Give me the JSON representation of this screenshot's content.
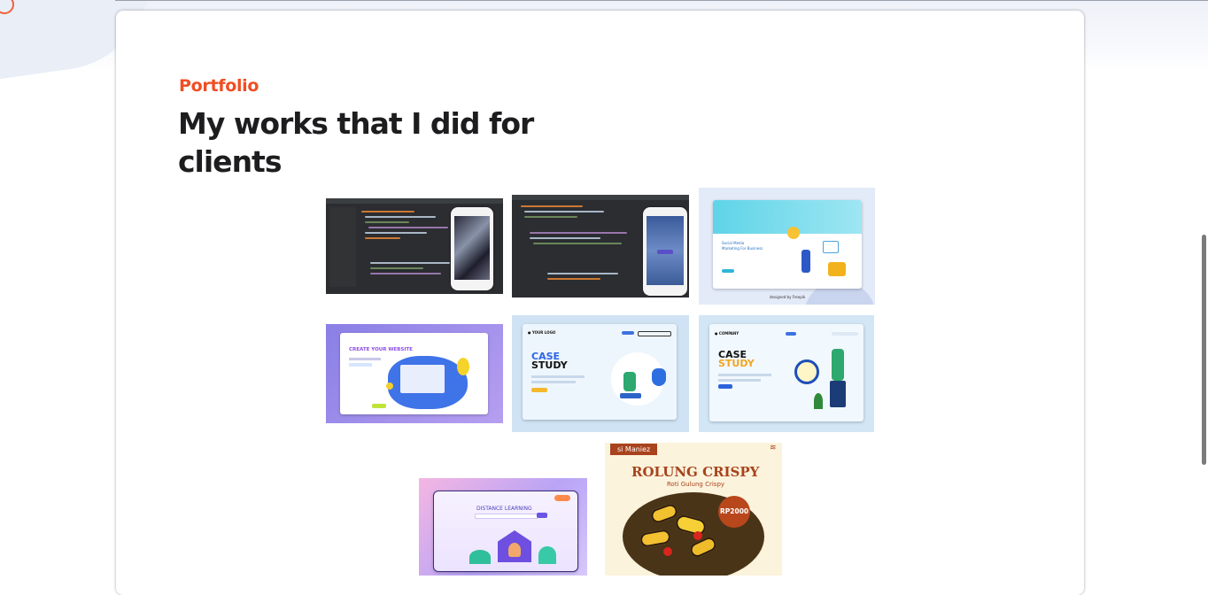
{
  "section": {
    "eyebrow": "Portfolio",
    "title": "My works that I did for clients"
  },
  "portfolio": {
    "items": [
      {
        "name": "android-code-editor-phone-app"
      },
      {
        "name": "android-code-editor-login-app"
      },
      {
        "name": "social-media-marketing-landing",
        "caption": "Social Media\nMarketing For Business",
        "credit": "designed by Freepik"
      },
      {
        "name": "create-your-website-landing",
        "caption": "CREATE YOUR WEBSITE"
      },
      {
        "name": "case-study-landing-1",
        "logo": "YOUR LOGO",
        "caption": "CASE\nSTUDY"
      },
      {
        "name": "case-study-landing-2",
        "logo": "COMPANY",
        "caption": "CASE\nSTUDY"
      },
      {
        "name": "distance-learning-landing",
        "caption": "DISTANCE LEARNING"
      },
      {
        "name": "rolung-crispy-promo",
        "brand": "si Maniez",
        "caption": "ROLUNG CRISPY",
        "subcaption": "Roti Gulung Crispy",
        "price": "RP2000"
      }
    ]
  },
  "colors": {
    "accent": "#f04e23",
    "heading": "#1d1d1f",
    "rolung": "#a8431d"
  }
}
